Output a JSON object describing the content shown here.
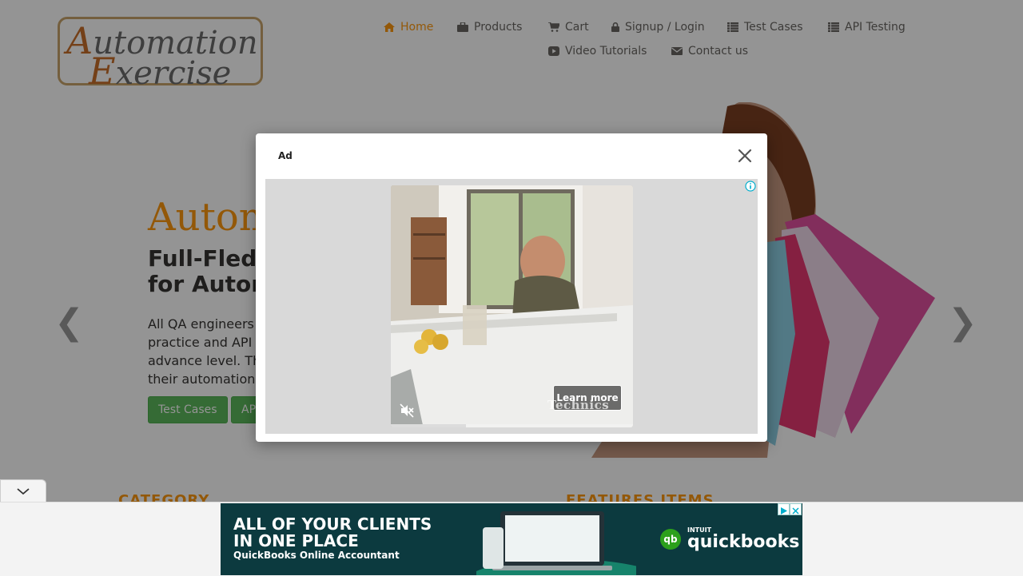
{
  "logo": {
    "line1_cap": "A",
    "line1_rest": "utomation",
    "line2_cap": "E",
    "line2_rest": "xercise"
  },
  "nav": {
    "items": [
      {
        "label": "Home",
        "icon": "home-icon"
      },
      {
        "label": "Products",
        "icon": "briefcase-icon"
      },
      {
        "label": "Cart",
        "icon": "cart-icon"
      },
      {
        "label": "Signup / Login",
        "icon": "lock-icon"
      },
      {
        "label": "Test Cases",
        "icon": "list-icon"
      },
      {
        "label": "API Testing",
        "icon": "list-icon"
      },
      {
        "label": "Video Tutorials",
        "icon": "youtube-play-icon"
      },
      {
        "label": "Contact us",
        "icon": "envelope-icon"
      }
    ],
    "active": "Home"
  },
  "hero": {
    "title_partial": "Autom",
    "subtitle_line1": "Full-Fled",
    "subtitle_line2": "for Autom",
    "desc_lines": [
      "All QA engineers",
      "practice and API",
      "advance level. Th",
      "their automation"
    ],
    "buttons": [
      "Test Cases",
      "AP"
    ]
  },
  "sections": {
    "category_partial": "CATEGORY",
    "features_partial": "FEATURES ITEMS"
  },
  "ad_modal": {
    "label": "Ad",
    "learn_more": "Learn more",
    "watermark": "Technics",
    "progress": 0.31
  },
  "banner": {
    "headline": "ALL OF YOUR CLIENTS\nIN ONE PLACE",
    "sub": "QuickBooks Online Accountant",
    "brand_top": "INTUIT",
    "brand": "quickbooks",
    "qb_mark": "qb"
  },
  "colors": {
    "accent": "#fe980f",
    "button_green": "#5cb85c",
    "banner_bg": "#0c3a3f",
    "overlay": "rgba(0,0,0,0.42)"
  }
}
